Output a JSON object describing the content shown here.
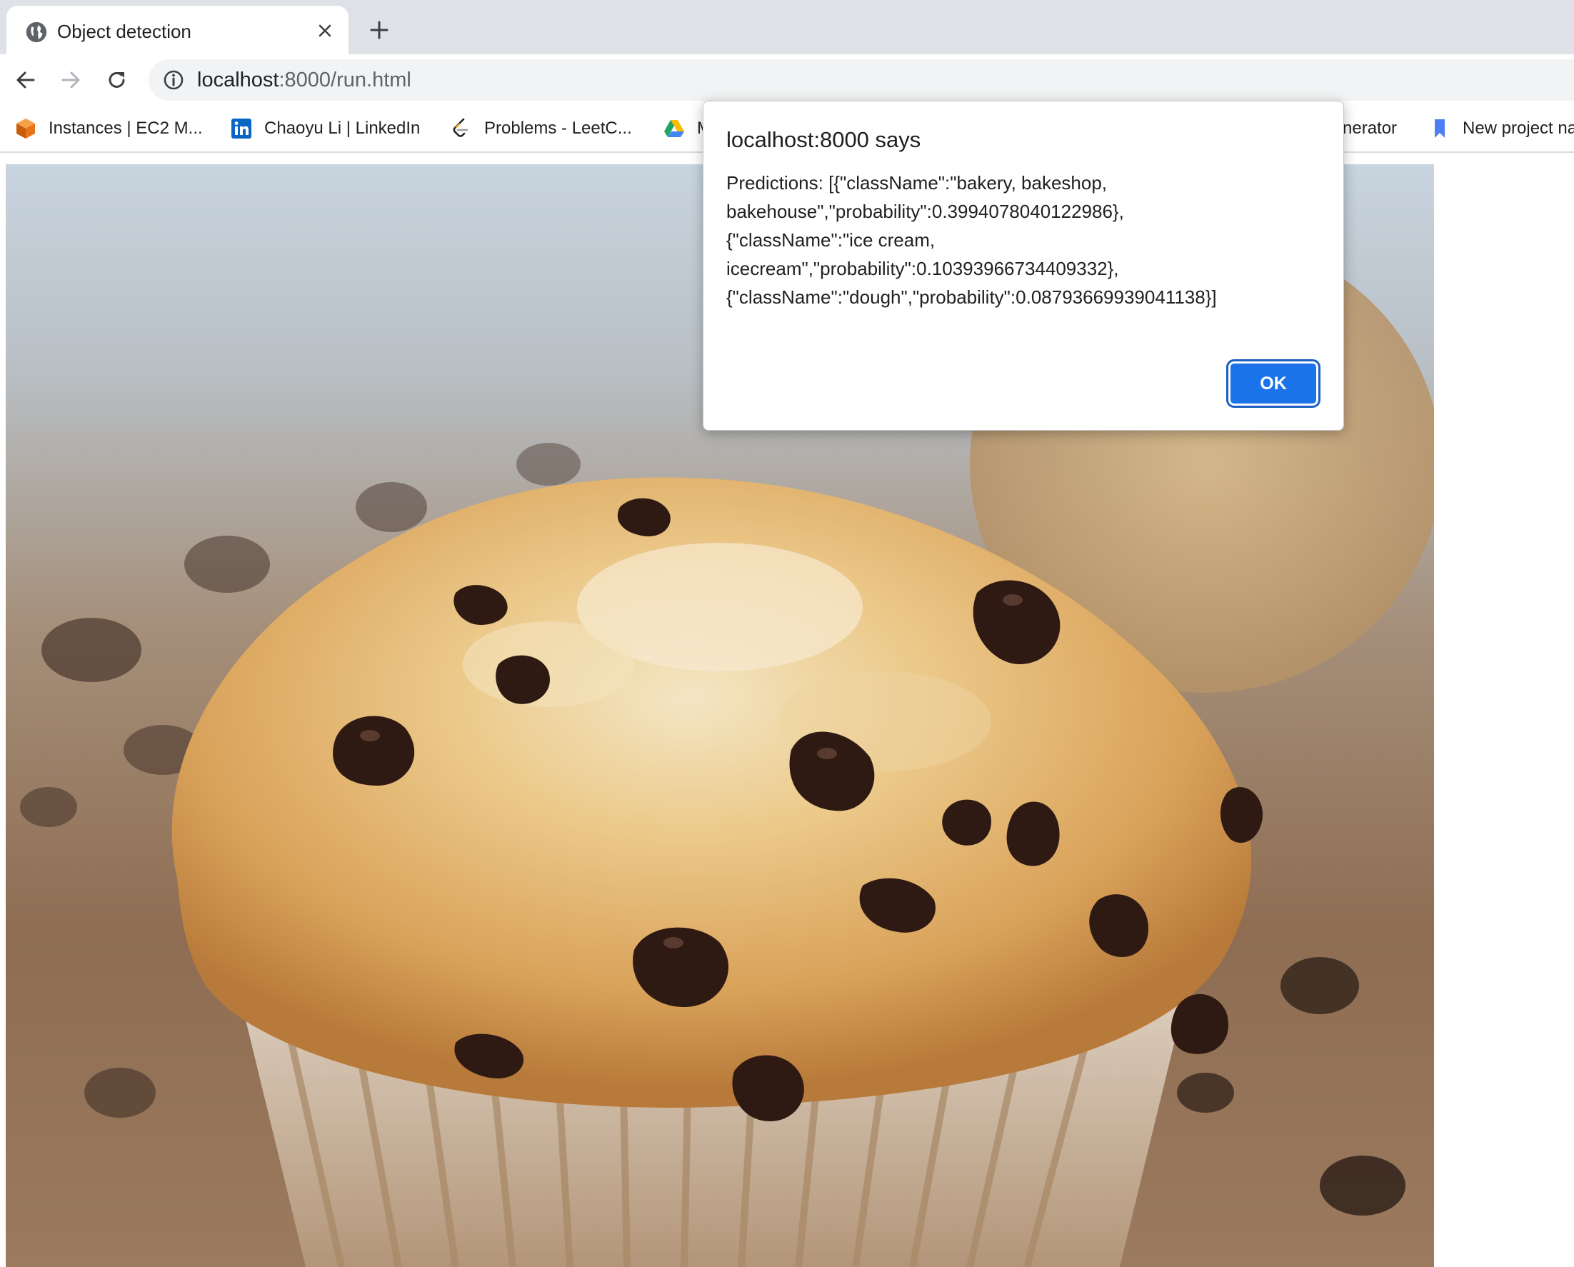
{
  "tab": {
    "title": "Object detection",
    "favicon_icon": "globe-icon",
    "close_icon": "close-icon"
  },
  "new_tab_icon": "plus-icon",
  "toolbar": {
    "back_icon": "arrow-left-icon",
    "forward_icon": "arrow-right-icon",
    "reload_icon": "reload-icon",
    "site_info_icon": "info-icon",
    "url_host": "localhost",
    "url_rest": ":8000/run.html"
  },
  "bookmarks": [
    {
      "label": "Instances | EC2 M...",
      "icon": "aws-cube-icon"
    },
    {
      "label": "Chaoyu Li | LinkedIn",
      "icon": "linkedin-icon"
    },
    {
      "label": "Problems - LeetC...",
      "icon": "leetcode-icon"
    },
    {
      "label": "M",
      "icon": "google-drive-icon"
    },
    {
      "label": "nerator",
      "icon": ""
    },
    {
      "label": "New project na",
      "icon": "bookmark-icon"
    }
  ],
  "dialog": {
    "title": "localhost:8000 says",
    "message_lines": [
      "Predictions: [{\"className\":\"bakery, bakeshop,",
      "bakehouse\",\"probability\":0.3994078040122986},",
      "{\"className\":\"ice cream,",
      "icecream\",\"probability\":0.10393966734409332},",
      "{\"className\":\"dough\",\"probability\":0.08793669939041138}]"
    ],
    "ok_label": "OK"
  },
  "colors": {
    "tabstrip_bg": "#dee1e6",
    "omnibox_bg": "#f1f3f4",
    "accent_blue": "#1a73e8"
  }
}
